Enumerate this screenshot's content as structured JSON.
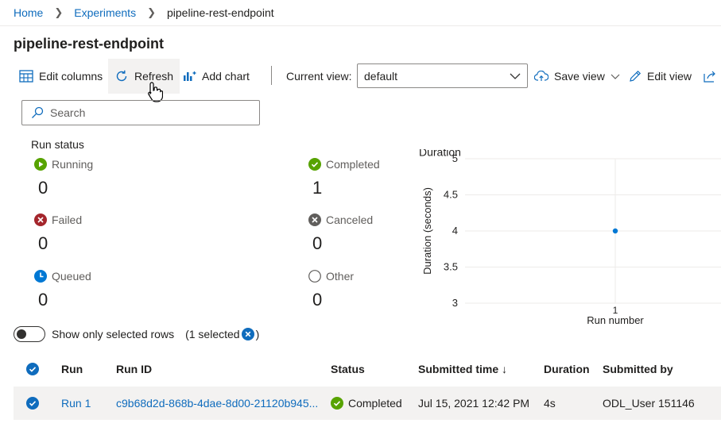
{
  "breadcrumb": {
    "items": [
      "Home",
      "Experiments",
      "pipeline-rest-endpoint"
    ]
  },
  "page": {
    "title": "pipeline-rest-endpoint"
  },
  "toolbar": {
    "edit_columns": "Edit columns",
    "refresh": "Refresh",
    "add_chart": "Add chart",
    "current_view_label": "Current view:",
    "current_view_value": "default",
    "save_view": "Save view",
    "edit_view": "Edit view"
  },
  "search": {
    "placeholder": "Search"
  },
  "run_status": {
    "title": "Run status",
    "items": [
      {
        "label": "Running",
        "count": "0",
        "color": "#57a300"
      },
      {
        "label": "Completed",
        "count": "1",
        "color": "#57a300"
      },
      {
        "label": "Failed",
        "count": "0",
        "color": "#a4262c"
      },
      {
        "label": "Canceled",
        "count": "0",
        "color": "#605e5c"
      },
      {
        "label": "Queued",
        "count": "0",
        "color": "#0078d4"
      },
      {
        "label": "Other",
        "count": "0",
        "color": "#605e5c"
      }
    ]
  },
  "chart_data": {
    "type": "scatter",
    "title": "Duration",
    "xlabel": "Run number",
    "ylabel": "Duration (seconds)",
    "x": [
      1
    ],
    "y": [
      4
    ],
    "x_ticks": [
      "1"
    ],
    "y_ticks": [
      "5",
      "4.5",
      "4",
      "3.5",
      "3"
    ],
    "ylim": [
      3,
      5
    ],
    "grid": true,
    "point_color": "#0078d4"
  },
  "selection": {
    "toggle_label": "Show only selected rows",
    "selected_text": "(1 selected",
    "close_paren": ")"
  },
  "table": {
    "columns": [
      "Run",
      "Run ID",
      "Status",
      "Submitted time ↓",
      "Duration",
      "Submitted by"
    ],
    "rows": [
      {
        "run": "Run 1",
        "run_id": "c9b68d2d-868b-4dae-8d00-21120b945...",
        "status": "Completed",
        "submitted_time": "Jul 15, 2021 12:42 PM",
        "duration": "4s",
        "submitted_by": "ODL_User 151146"
      }
    ]
  }
}
